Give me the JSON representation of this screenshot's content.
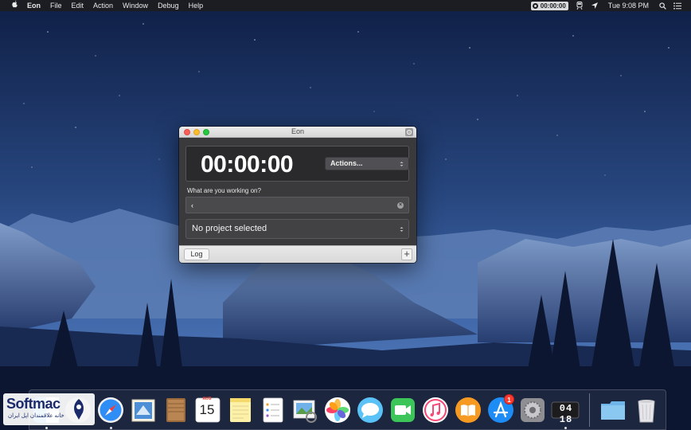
{
  "menubar": {
    "app_name": "Eon",
    "menus": [
      "File",
      "Edit",
      "Action",
      "Window",
      "Debug",
      "Help"
    ],
    "timer": "00:00:00",
    "clock": "Tue 9:08 PM"
  },
  "window": {
    "title": "Eon",
    "timer_display": "00:00:00",
    "actions_label": "Actions...",
    "working_label": "What are you working on?",
    "task_input_value": "‹",
    "project_label": "No project selected",
    "log_label": "Log",
    "add_label": "+"
  },
  "dock": {
    "calendar_month": "AUG",
    "calendar_day": "15",
    "app_store_badge": "1",
    "digital_time": "04 18"
  },
  "watermark": {
    "brand": "Softmac",
    "tagline": "خانه علاقمندان اپل ایران"
  },
  "colors": {
    "sky": "#1e3566",
    "menubar": "#1b1d22",
    "window_body": "#3a3a3c",
    "close": "#fc5f57",
    "minimize": "#fdbc2e",
    "zoom": "#28c840",
    "badge": "#fb3b30"
  }
}
